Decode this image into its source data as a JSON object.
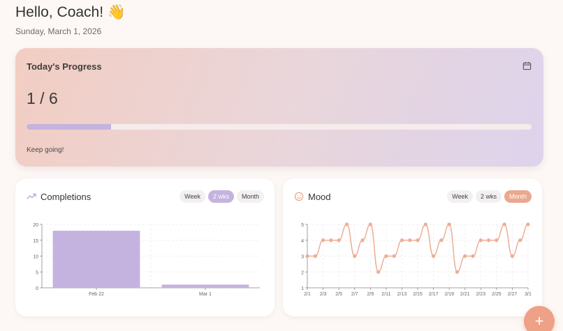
{
  "header": {
    "greeting": "Hello, Coach! 👋",
    "date": "Sunday, March 1, 2026"
  },
  "progress": {
    "title": "Today's Progress",
    "count_text": "1 / 6",
    "fraction": 0.1667,
    "message": "Keep going!",
    "icon": "calendar-icon"
  },
  "completions": {
    "title": "Completions",
    "icon": "trending-up-icon",
    "ranges": [
      "Week",
      "2 wks",
      "Month"
    ],
    "active_range": "2 wks"
  },
  "mood": {
    "title": "Mood",
    "icon": "smile-icon",
    "ranges": [
      "Week",
      "2 wks",
      "Month"
    ],
    "active_range": "Month"
  },
  "colors": {
    "accent_purple": "#c5b3df",
    "accent_peach": "#eea187",
    "line_peach": "#efad95"
  },
  "fab": {
    "label": "+"
  },
  "chart_data": [
    {
      "type": "bar",
      "categories": [
        "Feb 22",
        "Mar 1"
      ],
      "values": [
        18,
        1
      ],
      "ylim": [
        0,
        20
      ],
      "yticks": [
        0,
        5,
        10,
        15,
        20
      ],
      "grid": true
    },
    {
      "type": "line",
      "x": [
        "2/1",
        "2/2",
        "2/3",
        "2/4",
        "2/5",
        "2/6",
        "2/7",
        "2/8",
        "2/9",
        "2/10",
        "2/11",
        "2/12",
        "2/13",
        "2/14",
        "2/15",
        "2/16",
        "2/17",
        "2/18",
        "2/19",
        "2/20",
        "2/21",
        "2/22",
        "2/23",
        "2/24",
        "2/25",
        "2/26",
        "2/27",
        "2/28",
        "3/1"
      ],
      "xticks": [
        "2/1",
        "2/3",
        "2/5",
        "2/7",
        "2/9",
        "2/11",
        "2/13",
        "2/15",
        "2/17",
        "2/19",
        "2/21",
        "2/23",
        "2/25",
        "2/27",
        "3/1"
      ],
      "series": [
        {
          "values": [
            3,
            3,
            4,
            4,
            4,
            5,
            3,
            4,
            5,
            2,
            3,
            3,
            4,
            4,
            4,
            5,
            3,
            4,
            5,
            2,
            3,
            3,
            4,
            4,
            4,
            5,
            3,
            4,
            5
          ]
        }
      ],
      "ylim": [
        1,
        5
      ],
      "yticks": [
        1,
        2,
        3,
        4,
        5
      ],
      "grid": true
    }
  ]
}
